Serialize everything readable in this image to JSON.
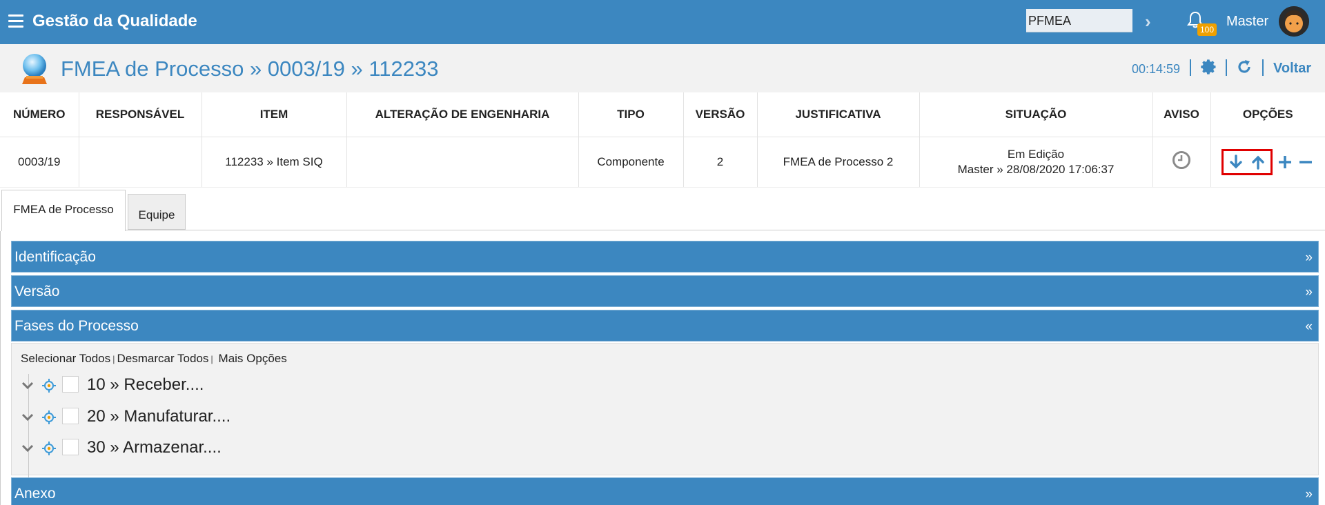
{
  "app": {
    "title": "Gestão da Qualidade",
    "search_value": "PFMEA",
    "notification_count": "100",
    "user_name": "Master"
  },
  "header": {
    "title": "FMEA de Processo » 0003/19 » 112233",
    "timer": "00:14:59",
    "back_label": "Voltar"
  },
  "table": {
    "columns": [
      "NÚMERO",
      "RESPONSÁVEL",
      "ITEM",
      "ALTERAÇÃO DE ENGENHARIA",
      "TIPO",
      "VERSÃO",
      "JUSTIFICATIVA",
      "SITUAÇÃO",
      "AVISO",
      "OPÇÕES"
    ],
    "row": {
      "numero": "0003/19",
      "responsavel": "",
      "item": "112233 » Item SIQ",
      "alteracao": "",
      "tipo": "Componente",
      "versao": "2",
      "justificativa": "FMEA de Processo 2",
      "situacao_status": "Em Edição",
      "situacao_detail": "Master » 28/08/2020 17:06:37"
    }
  },
  "tabs": [
    {
      "label": "FMEA de Processo"
    },
    {
      "label": "Equipe"
    }
  ],
  "sections": [
    {
      "label": "Identificação",
      "chevron": "»"
    },
    {
      "label": "Versão",
      "chevron": "»"
    },
    {
      "label": "Fases do Processo",
      "chevron": "«"
    },
    {
      "label": "Anexo",
      "chevron": "»"
    }
  ],
  "phase_links": {
    "select_all": "Selecionar Todos",
    "deselect_all": "Desmarcar Todos",
    "more_options": "Mais Opções",
    "separator": "|"
  },
  "phases": [
    {
      "label": "10 » Receber...."
    },
    {
      "label": "20 » Manufaturar...."
    },
    {
      "label": "30 » Armazenar...."
    }
  ],
  "colors": {
    "primary": "#3c87c0",
    "highlight_border": "#e00000",
    "badge": "#f0a000"
  },
  "icons": {
    "menu": "hamburger-icon",
    "bell": "bell-icon",
    "settings": "gear-icon",
    "refresh": "refresh-icon",
    "aviso": "clock-icon",
    "move_down": "arrow-down-icon",
    "move_up": "arrow-up-icon",
    "add": "plus-icon",
    "remove": "minus-icon",
    "tree_toggle": "chevron-down-icon",
    "tree_target": "crosshair-icon"
  }
}
